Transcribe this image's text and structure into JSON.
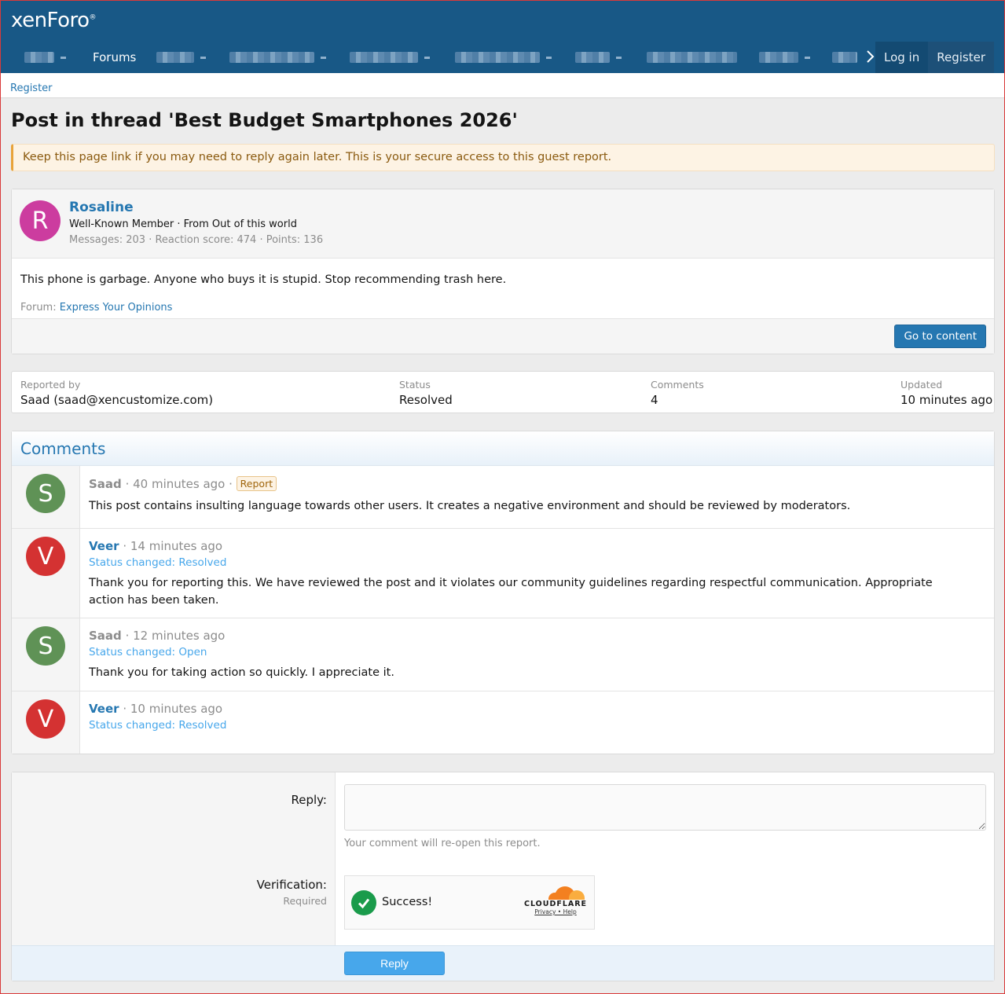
{
  "header": {
    "logo": "xenForo",
    "logo_mark": "®",
    "nav": {
      "forums": "Forums",
      "login": "Log in",
      "register": "Register"
    },
    "nav_overflow_icon": "chevron-right-icon"
  },
  "breadcrumb": {
    "register": "Register"
  },
  "page": {
    "title": "Post in thread 'Best Budget Smartphones 2026'",
    "notice": "Keep this page link if you may need to reply again later. This is your secure access to this guest report."
  },
  "post": {
    "avatar_letter": "R",
    "user": "Rosaline",
    "user_title": "Well-Known Member · From Out of this world",
    "user_stats": "Messages: 203 · Reaction score: 474 · Points: 136",
    "body": "This phone is garbage. Anyone who buys it is stupid. Stop recommending trash here.",
    "forum_label": "Forum:",
    "forum_name": "Express Your Opinions",
    "goto_button": "Go to content"
  },
  "report_info": {
    "reported_by_label": "Reported by",
    "reported_by": "Saad (saad@xencustomize.com)",
    "status_label": "Status",
    "status": "Resolved",
    "comments_label": "Comments",
    "comments": "4",
    "updated_label": "Updated",
    "updated": "10 minutes ago"
  },
  "comments": {
    "title": "Comments",
    "items": [
      {
        "letter": "S",
        "user": "Saad",
        "time": "· 40 minutes ago ·",
        "badge": "Report",
        "status": "",
        "text": "This post contains insulting language towards other users. It creates a negative environment and should be reviewed by moderators."
      },
      {
        "letter": "V",
        "user": "Veer",
        "time": "· 14 minutes ago",
        "badge": "",
        "status": "Status changed: Resolved",
        "text": "Thank you for reporting this. We have reviewed the post and it violates our community guidelines regarding respectful communication. Appropriate action has been taken."
      },
      {
        "letter": "S",
        "user": "Saad",
        "time": "· 12 minutes ago",
        "badge": "",
        "status": "Status changed: Open",
        "text": "Thank you for taking action so quickly. I appreciate it."
      },
      {
        "letter": "V",
        "user": "Veer",
        "time": "· 10 minutes ago",
        "badge": "",
        "status": "Status changed: Resolved",
        "text": ""
      }
    ]
  },
  "reply_form": {
    "reply_label": "Reply:",
    "reply_value": "",
    "reply_hint": "Your comment will re-open this report.",
    "verification_label": "Verification:",
    "verification_required": "Required",
    "captcha_status": "Success!",
    "captcha_brand": "CLOUDFLARE",
    "captcha_links": "Privacy • Help",
    "submit": "Reply"
  },
  "colors": {
    "header_bg": "#185886",
    "link": "#2577b1",
    "notice_bg": "#fdf3e4",
    "avatar_r": "#cc3c9f",
    "avatar_s": "#5f9256",
    "avatar_v": "#d43232",
    "button_reply": "#47a7eb",
    "cloudflare_orange": "#f38020"
  }
}
